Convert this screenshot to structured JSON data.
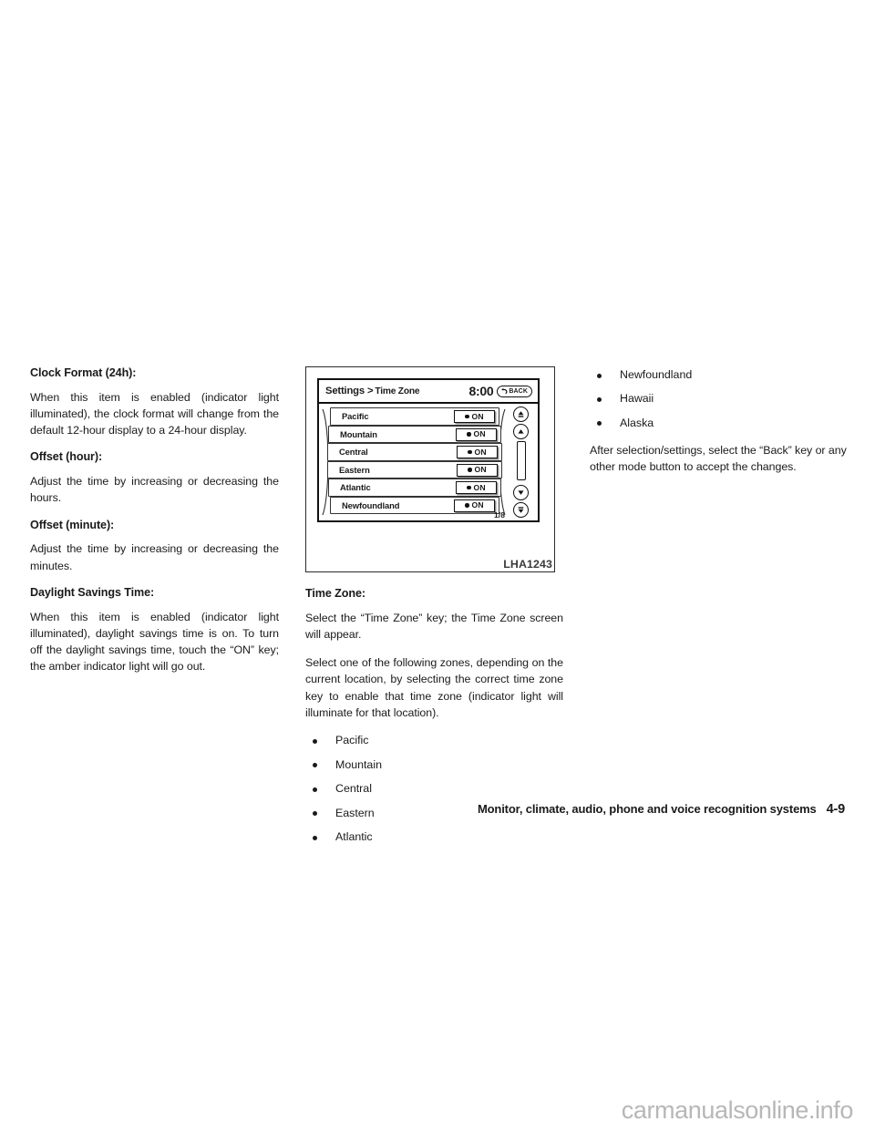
{
  "document": {
    "footer_title": "Monitor, climate, audio, phone and voice recognition systems",
    "footer_page": "4-9",
    "watermark": "carmanualsonline.info"
  },
  "left_column": {
    "sections": [
      {
        "heading": "Clock Format (24h):",
        "body": "When this item is enabled (indicator light illuminated), the clock format will change from the default 12-hour display to a 24-hour display."
      },
      {
        "heading": "Offset (hour):",
        "body": "Adjust the time by increasing or decreasing the hours."
      },
      {
        "heading": "Offset (minute):",
        "body": "Adjust the time by increasing or decreasing the minutes."
      },
      {
        "heading": "Daylight Savings Time:",
        "body": "When this item is enabled (indicator light illuminated), daylight savings time is on. To turn off the daylight savings time, touch the “ON” key; the amber indicator light will go out."
      }
    ]
  },
  "figure": {
    "code": "LHA1243",
    "screen": {
      "breadcrumb_root": "Settings",
      "breadcrumb_separator": ">",
      "breadcrumb_current": "Time Zone",
      "clock": "8:00",
      "back_label": "BACK",
      "back_icon": "back-arrow-icon",
      "page_indicator": "1/8",
      "rows": [
        {
          "label": "Pacific",
          "state": "ON"
        },
        {
          "label": "Mountain",
          "state": "ON"
        },
        {
          "label": "Central",
          "state": "ON"
        },
        {
          "label": "Eastern",
          "state": "ON"
        },
        {
          "label": "Atlantic",
          "state": "ON"
        },
        {
          "label": "Newfoundland",
          "state": "ON"
        }
      ],
      "scroll_buttons": [
        {
          "name": "scroll-top-button",
          "icon": "double-up-arrow-icon"
        },
        {
          "name": "scroll-up-button",
          "icon": "up-arrow-icon"
        },
        {
          "name": "scroll-down-button",
          "icon": "down-arrow-icon"
        },
        {
          "name": "scroll-bottom-button",
          "icon": "double-down-arrow-icon"
        }
      ]
    }
  },
  "middle_column": {
    "heading": "Time Zone:",
    "para1": "Select the “Time Zone” key; the Time Zone screen will appear.",
    "para2": "Select one of the following zones, depending on the current location, by selecting the correct time zone key to enable that time zone (indicator light will illuminate for that location).",
    "bullets": [
      "Pacific",
      "Mountain",
      "Central",
      "Eastern",
      "Atlantic"
    ]
  },
  "right_column": {
    "bullets": [
      "Newfoundland",
      "Hawaii",
      "Alaska"
    ],
    "para": "After selection/settings, select the “Back” key or any other mode button to accept the changes."
  },
  "colors": {
    "ink": "#1a1a1a",
    "rule": "#2b2b2b",
    "watermark": "#b7b7b7"
  }
}
